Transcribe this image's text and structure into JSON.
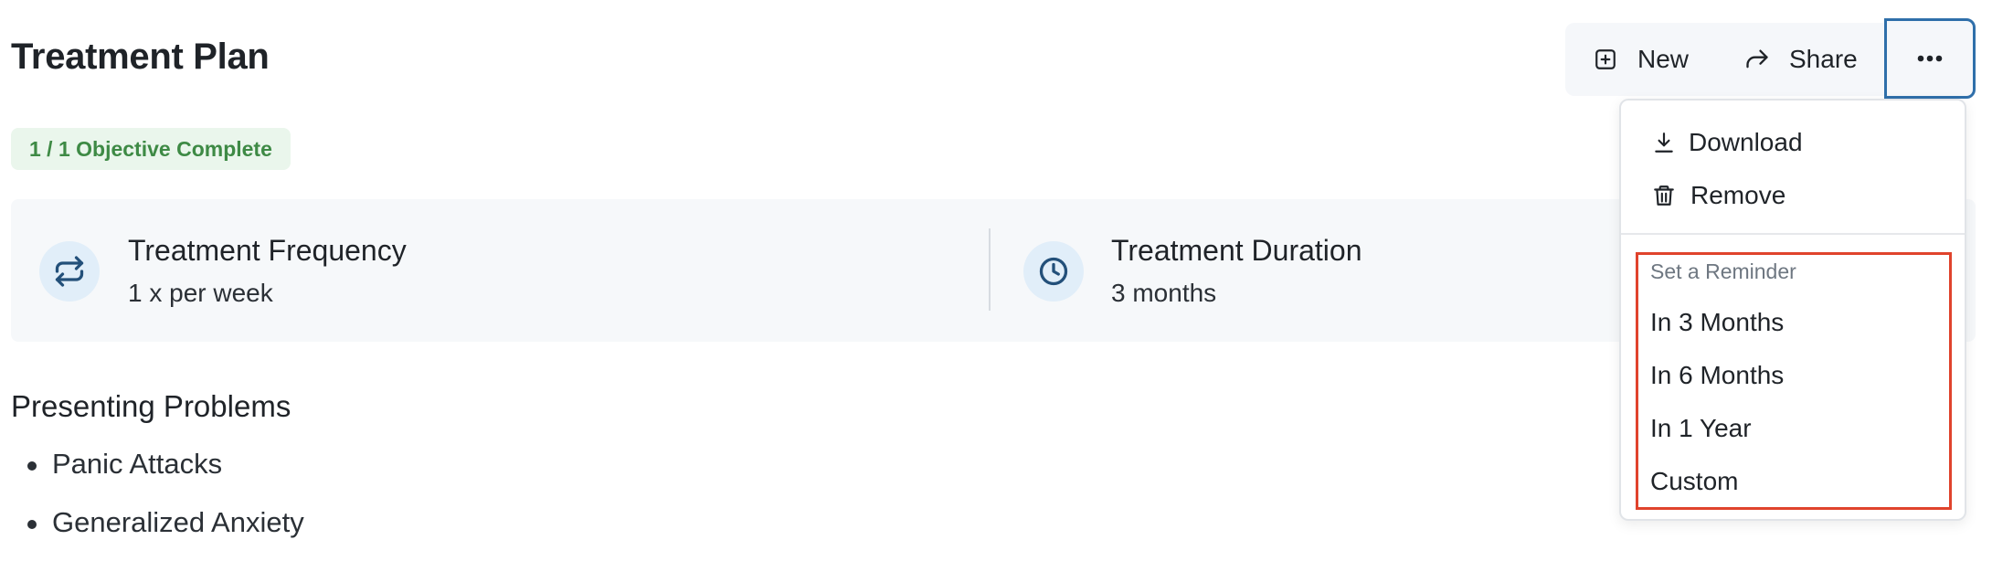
{
  "header": {
    "title": "Treatment Plan",
    "toolbar": {
      "new_label": "New",
      "share_label": "Share"
    }
  },
  "progress_badge": "1 / 1 Objective Complete",
  "info": {
    "frequency": {
      "title": "Treatment Frequency",
      "value": "1 x per week",
      "icon": "repeat-icon"
    },
    "duration": {
      "title": "Treatment Duration",
      "value": "3 months",
      "icon": "clock-icon"
    }
  },
  "presenting_problems": {
    "title": "Presenting Problems",
    "items": [
      "Panic Attacks",
      "Generalized Anxiety"
    ]
  },
  "menu": {
    "download_label": "Download",
    "remove_label": "Remove",
    "reminder_heading": "Set a Reminder",
    "reminder_options": [
      "In 3 Months",
      "In 6 Months",
      "In 1 Year",
      "Custom"
    ]
  },
  "colors": {
    "accent": "#2f6faa",
    "badge_text": "#3e8a45",
    "badge_bg": "#eaf6ec",
    "highlight": "#e0432c"
  }
}
